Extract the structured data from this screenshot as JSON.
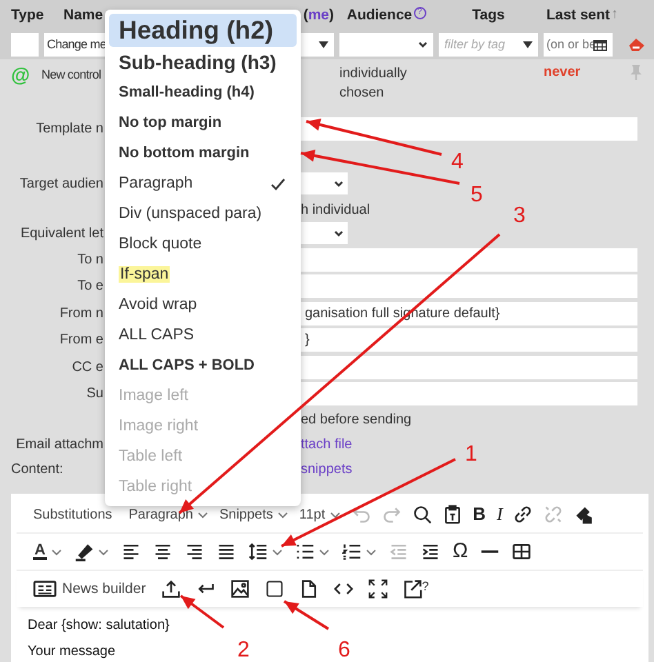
{
  "header": {
    "type": "Type",
    "name": "Name",
    "owner_open": "(",
    "owner_link": "me",
    "owner_close": ")",
    "audience": "Audience",
    "audience_help": "?",
    "tags": "Tags",
    "last_sent": "Last sent",
    "sort_arrow": "↑"
  },
  "filters": {
    "name_value": "Change me",
    "tags_placeholder": "filter by tag",
    "last_sent_placeholder": "(on or be"
  },
  "template_row": {
    "type_glyph": "@",
    "name": "New control",
    "audience": "individually chosen",
    "last_sent": "never"
  },
  "form": [
    {
      "kind": "field",
      "label": "Template n"
    },
    {
      "kind": "select",
      "label": "Target audien",
      "note": "h individual"
    },
    {
      "kind": "select",
      "label": "Equivalent let"
    },
    {
      "kind": "field",
      "label": "To n"
    },
    {
      "kind": "field",
      "label": "To e"
    },
    {
      "kind": "field",
      "label": "From n",
      "value": "ganisation full signature default}"
    },
    {
      "kind": "field",
      "label": "From e",
      "value": "}"
    },
    {
      "kind": "field",
      "label": "CC e"
    },
    {
      "kind": "field",
      "label": "Su"
    },
    {
      "kind": "text",
      "text": "ed before sending"
    },
    {
      "kind": "link",
      "label": "Email attachm",
      "text": "ttach file"
    }
  ],
  "content": {
    "label": "Content:",
    "link": "snippets"
  },
  "toolbar": {
    "dropdowns": [
      {
        "label": "Substitutions",
        "caret": false
      },
      {
        "label": "Paragraph",
        "caret": true
      },
      {
        "label": "Snippets",
        "caret": true
      },
      {
        "label": "11pt",
        "caret": true
      }
    ],
    "undo_disabled": true,
    "redo_disabled": true,
    "unlink_disabled": true,
    "outdent_disabled": true,
    "bold_glyph": "B",
    "italic_glyph": "I",
    "text_color_glyph": "A",
    "omega_glyph": "Ω",
    "news_builder": "News builder",
    "popout_glyph": "?"
  },
  "editor": {
    "lines": [
      "Dear {show: salutation}",
      "Your message"
    ]
  },
  "menu": [
    {
      "label": "Heading (h2)",
      "kind": "h2",
      "highlighted": true,
      "checked": false,
      "disabled": false
    },
    {
      "label": "Sub-heading (h3)",
      "kind": "h3",
      "highlighted": false,
      "checked": false,
      "disabled": false
    },
    {
      "label": "Small-heading (h4)",
      "kind": "h4",
      "highlighted": false,
      "checked": false,
      "disabled": false
    },
    {
      "label": "No top margin",
      "kind": "bold",
      "highlighted": false,
      "checked": false,
      "disabled": false
    },
    {
      "label": "No bottom margin",
      "kind": "bold",
      "highlighted": false,
      "checked": false,
      "disabled": false
    },
    {
      "label": "Paragraph",
      "kind": "plain",
      "highlighted": false,
      "checked": true,
      "disabled": false
    },
    {
      "label": "Div (unspaced para)",
      "kind": "plain",
      "highlighted": false,
      "checked": false,
      "disabled": false
    },
    {
      "label": "Block quote",
      "kind": "plain",
      "highlighted": false,
      "checked": false,
      "disabled": false
    },
    {
      "label": "If-span",
      "kind": "marked",
      "highlighted": false,
      "checked": false,
      "disabled": false
    },
    {
      "label": "Avoid wrap",
      "kind": "plain",
      "highlighted": false,
      "checked": false,
      "disabled": false
    },
    {
      "label": "ALL CAPS",
      "kind": "plain",
      "highlighted": false,
      "checked": false,
      "disabled": false
    },
    {
      "label": "ALL CAPS + BOLD",
      "kind": "bold",
      "highlighted": false,
      "checked": false,
      "disabled": false
    },
    {
      "label": "Image left",
      "kind": "plain",
      "highlighted": false,
      "checked": false,
      "disabled": true
    },
    {
      "label": "Image right",
      "kind": "plain",
      "highlighted": false,
      "checked": false,
      "disabled": true
    },
    {
      "label": "Table left",
      "kind": "plain",
      "highlighted": false,
      "checked": false,
      "disabled": true
    },
    {
      "label": "Table right",
      "kind": "plain",
      "highlighted": false,
      "checked": false,
      "disabled": true
    }
  ],
  "annotations": [
    {
      "number": "4"
    },
    {
      "number": "5"
    },
    {
      "number": "3"
    },
    {
      "number": "1"
    },
    {
      "number": "2"
    },
    {
      "number": "6"
    }
  ]
}
